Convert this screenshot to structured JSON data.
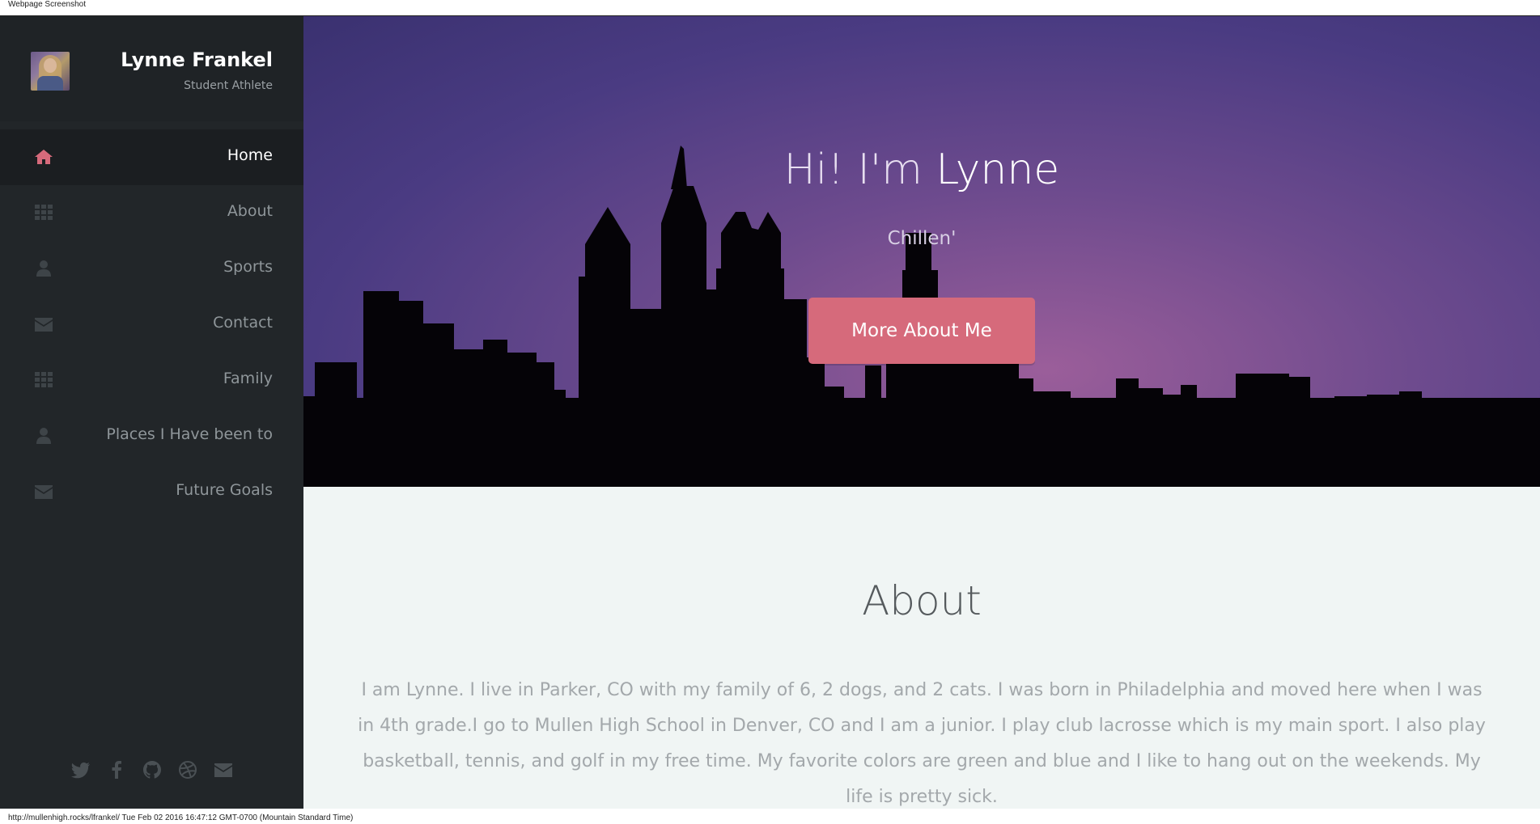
{
  "capture": {
    "header_label": "Webpage Screenshot",
    "footer_status": "http://mullenhigh.rocks/lfrankel/ Tue Feb 02 2016 16:47:12 GMT-0700 (Mountain Standard Time)"
  },
  "profile": {
    "name": "Lynne Frankel",
    "role": "Student Athlete"
  },
  "nav": {
    "items": [
      {
        "label": "Home",
        "icon": "home-icon",
        "active": true
      },
      {
        "label": "About",
        "icon": "grid-icon",
        "active": false
      },
      {
        "label": "Sports",
        "icon": "user-icon",
        "active": false
      },
      {
        "label": "Contact",
        "icon": "envelope-icon",
        "active": false
      },
      {
        "label": "Family",
        "icon": "grid-icon",
        "active": false
      },
      {
        "label": "Places I Have been to",
        "icon": "user-icon",
        "active": false
      },
      {
        "label": "Future Goals",
        "icon": "envelope-icon",
        "active": false
      }
    ]
  },
  "social": [
    "twitter-icon",
    "facebook-icon",
    "github-icon",
    "dribbble-icon",
    "envelope-icon"
  ],
  "hero": {
    "title_prefix": "Hi! I'm ",
    "title_name": "Lynne",
    "subtitle": "Chillen'",
    "button_label": "More About Me"
  },
  "about": {
    "title": "About",
    "text": "I am Lynne. I live in Parker, CO with my family of 6, 2 dogs, and 2 cats. I was born in Philadelphia and moved here when I was in 4th grade.I go to Mullen High School in Denver, CO and I am a junior. I play club lacrosse which is my main sport. I also play basketball, tennis, and golf in my free time. My favorite colors are green and blue and I like to hang out on the weekends. My life is pretty sick."
  },
  "colors": {
    "sidebar_bg": "#222629",
    "accent": "#d66a7b",
    "about_bg": "#f0f5f4"
  }
}
